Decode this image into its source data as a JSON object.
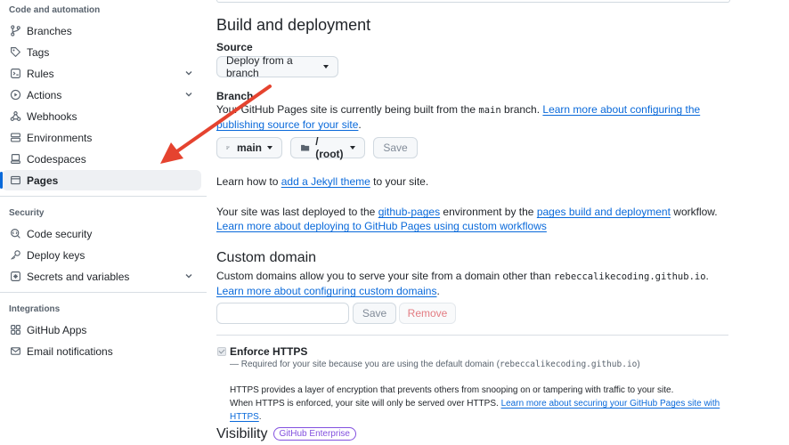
{
  "sidebar": {
    "section_code": "Code and automation",
    "items_code": [
      {
        "label": "Branches",
        "icon": "branch-icon"
      },
      {
        "label": "Tags",
        "icon": "tag-icon"
      },
      {
        "label": "Rules",
        "icon": "rules-icon",
        "expandable": true
      },
      {
        "label": "Actions",
        "icon": "play-icon",
        "expandable": true
      },
      {
        "label": "Webhooks",
        "icon": "webhook-icon"
      },
      {
        "label": "Environments",
        "icon": "server-icon"
      },
      {
        "label": "Codespaces",
        "icon": "codespaces-icon"
      },
      {
        "label": "Pages",
        "icon": "browser-icon",
        "active": true
      }
    ],
    "section_security": "Security",
    "items_security": [
      {
        "label": "Code security",
        "icon": "codescan-icon"
      },
      {
        "label": "Deploy keys",
        "icon": "key-icon"
      },
      {
        "label": "Secrets and variables",
        "icon": "plus-square-icon",
        "expandable": true
      }
    ],
    "section_integrations": "Integrations",
    "items_integrations": [
      {
        "label": "GitHub Apps",
        "icon": "apps-icon"
      },
      {
        "label": "Email notifications",
        "icon": "mail-icon"
      }
    ]
  },
  "build": {
    "title": "Build and deployment",
    "source_label": "Source",
    "source_value": "Deploy from a branch",
    "branch_label": "Branch",
    "branch_text_1": "Your GitHub Pages site is currently being built from the",
    "branch_code": "main",
    "branch_text_2": "branch.",
    "branch_link": "Learn more about configuring the publishing source for your site",
    "branch_period": ".",
    "branch_button": "main",
    "folder_button": "/ (root)",
    "save_button": "Save",
    "jekyll_text_1": "Learn how to",
    "jekyll_link": "add a Jekyll theme",
    "jekyll_text_2": "to your site.",
    "deploy_text_1": "Your site was last deployed to the",
    "deploy_link_env": "github-pages",
    "deploy_text_2": "environment by the",
    "deploy_link_workflow": "pages build and deployment",
    "deploy_text_3": "workflow.",
    "deploy_link_custom": "Learn more about deploying to GitHub Pages using custom workflows"
  },
  "custom_domain": {
    "title": "Custom domain",
    "text_1": "Custom domains allow you to serve your site from a domain other than",
    "domain_code": "rebeccalikecoding.github.io",
    "text_period": ".",
    "link": "Learn more about configuring custom domains",
    "link_period": ".",
    "input_value": "",
    "save_button": "Save",
    "remove_button": "Remove"
  },
  "https": {
    "label": "Enforce HTTPS",
    "required_text_1": "— Required for your site because you are using the default domain (",
    "required_code": "rebeccalikecoding.github.io",
    "required_text_2": ")",
    "desc_1": "HTTPS provides a layer of encryption that prevents others from snooping on or tampering with traffic to your site.",
    "desc_2": "When HTTPS is enforced, your site will only be served over HTTPS.",
    "desc_link": "Learn more about securing your GitHub Pages site with HTTPS",
    "desc_period": "."
  },
  "visibility": {
    "title": "Visibility",
    "badge": "GitHub Enterprise"
  },
  "colors": {
    "accent": "#0969da",
    "annotation_arrow": "#e5432f",
    "badge": "#8250df"
  }
}
